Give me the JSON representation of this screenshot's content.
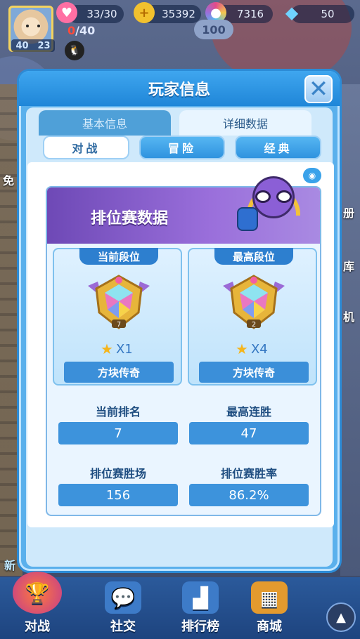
{
  "topbar": {
    "hearts": "33/30",
    "gold": "35392",
    "gems_purple": "7316",
    "diamonds": "50",
    "level_left": "40",
    "level_right": "23",
    "stamina_current": "0",
    "stamina_max": "/40",
    "stat_badge": "100"
  },
  "dialog": {
    "title": "玩家信息",
    "close_label": "✕"
  },
  "tabs": [
    {
      "label": "基本信息",
      "active": false
    },
    {
      "label": "详细数据",
      "active": true
    }
  ],
  "subtabs": [
    {
      "label": "对战",
      "active": true
    },
    {
      "label": "冒险",
      "active": false
    },
    {
      "label": "经典",
      "active": false
    }
  ],
  "ranked": {
    "title": "排位赛数据",
    "current": {
      "tag": "当前段位",
      "emblem_number": "7",
      "stars": "X1",
      "name": "方块传奇"
    },
    "best": {
      "tag": "最高段位",
      "emblem_number": "2",
      "stars": "X4",
      "name": "方块传奇"
    },
    "stats": [
      {
        "label": "当前排名",
        "value": "7"
      },
      {
        "label": "最高连胜",
        "value": "47"
      },
      {
        "label": "排位赛胜场",
        "value": "156"
      },
      {
        "label": "排位赛胜率",
        "value": "86.2%"
      }
    ]
  },
  "background": {
    "left_label_1": "免",
    "left_label_2": "新",
    "right_label_1": "册",
    "right_label_2": "库",
    "right_label_3": "机"
  },
  "bottom_nav": [
    {
      "label": "对战",
      "icon": "trophy-icon",
      "active": true
    },
    {
      "label": "社交",
      "icon": "chat-icon",
      "active": false
    },
    {
      "label": "排行榜",
      "icon": "podium-icon",
      "active": false
    },
    {
      "label": "商城",
      "icon": "shop-icon",
      "active": false
    }
  ],
  "colors": {
    "dialog_blue": "#5ab0ec",
    "header_blue": "#1f86d8",
    "ranked_purple": "#7b55c4",
    "value_blue": "#3d93dc",
    "stamina_red": "#ff4a3a"
  }
}
